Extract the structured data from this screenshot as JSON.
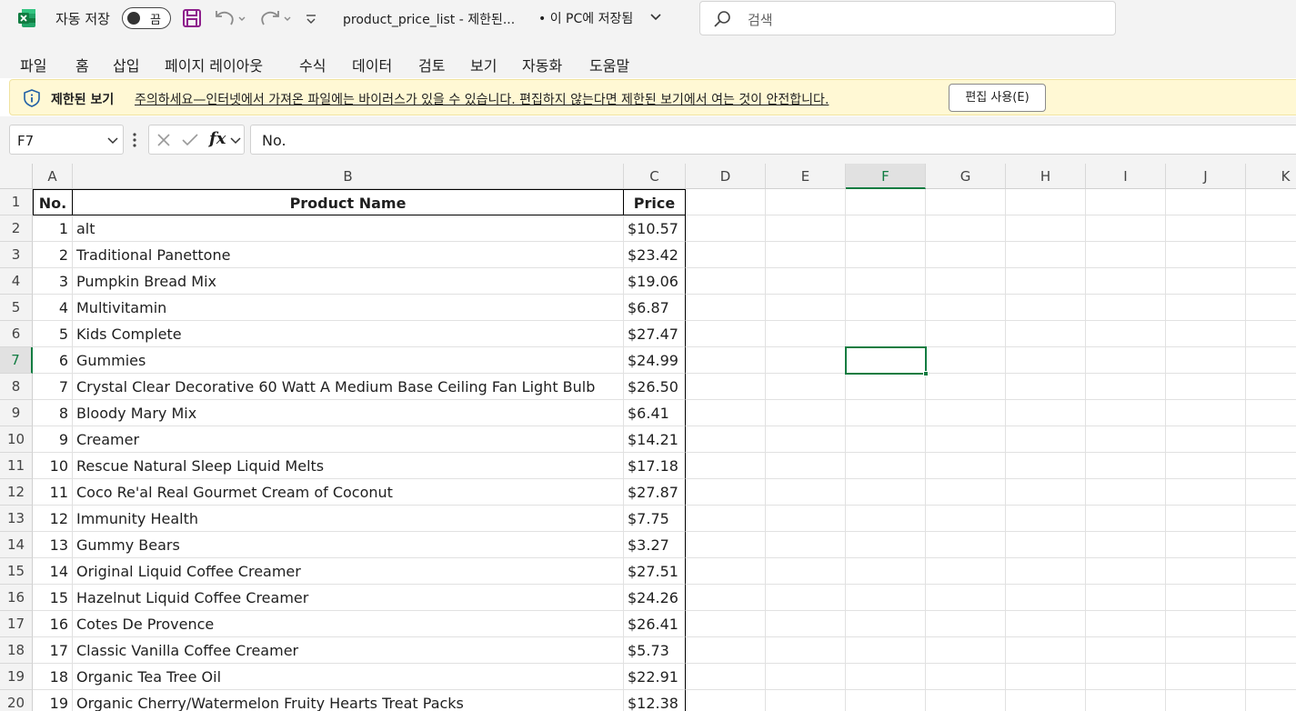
{
  "titlebar": {
    "autosave_label": "자동 저장",
    "autosave_state": "끔",
    "doc_name": "product_price_list  -  제한된...",
    "doc_status": "• 이 PC에 저장됨",
    "search_placeholder": "검색"
  },
  "ribbon": {
    "tabs": [
      "파일",
      "홈",
      "삽입",
      "페이지 레이아웃",
      "수식",
      "데이터",
      "검토",
      "보기",
      "자동화",
      "도움말"
    ]
  },
  "protected_view": {
    "title": "제한된 보기",
    "message": "주의하세요—인터넷에서 가져온 파일에는 바이러스가 있을 수 있습니다. 편집하지 않는다면 제한된 보기에서 여는 것이 안전합니다.",
    "button": "편집 사용(E)"
  },
  "formula_bar": {
    "name_box": "F7",
    "fx": "fx",
    "content": "No."
  },
  "columns": [
    "A",
    "B",
    "C",
    "D",
    "E",
    "F",
    "G",
    "H",
    "I",
    "J",
    "K"
  ],
  "selected_column": "F",
  "selected_row": 7,
  "table": {
    "headers": [
      "No.",
      "Product Name",
      "Price"
    ],
    "rows": [
      [
        "1",
        "alt",
        "$10.57"
      ],
      [
        "2",
        "Traditional Panettone",
        "$23.42"
      ],
      [
        "3",
        "Pumpkin Bread Mix",
        "$19.06"
      ],
      [
        "4",
        "Multivitamin",
        "$6.87"
      ],
      [
        "5",
        "Kids Complete",
        "$27.47"
      ],
      [
        "6",
        "Gummies",
        "$24.99"
      ],
      [
        "7",
        "Crystal Clear Decorative 60 Watt A Medium Base Ceiling Fan Light Bulb",
        "$26.50"
      ],
      [
        "8",
        "Bloody Mary Mix",
        "$6.41"
      ],
      [
        "9",
        "Creamer",
        "$14.21"
      ],
      [
        "10",
        "Rescue Natural Sleep Liquid Melts",
        "$17.18"
      ],
      [
        "11",
        "Coco Re'al Real Gourmet Cream of Coconut",
        "$27.87"
      ],
      [
        "12",
        "Immunity Health",
        "$7.75"
      ],
      [
        "13",
        "Gummy Bears",
        "$3.27"
      ],
      [
        "14",
        "Original Liquid Coffee Creamer",
        "$27.51"
      ],
      [
        "15",
        "Hazelnut Liquid Coffee Creamer",
        "$24.26"
      ],
      [
        "16",
        "Cotes De Provence",
        "$26.41"
      ],
      [
        "17",
        "Classic Vanilla Coffee Creamer",
        "$5.73"
      ],
      [
        "18",
        "Organic Tea Tree Oil",
        "$22.91"
      ],
      [
        "19",
        "Organic Cherry/Watermelon Fruity Hearts Treat Packs",
        "$12.38"
      ]
    ]
  },
  "colors": {
    "excel_green": "#107c41",
    "chrome_bg": "#f3f3f3",
    "protected_bg": "#fff8d4"
  }
}
